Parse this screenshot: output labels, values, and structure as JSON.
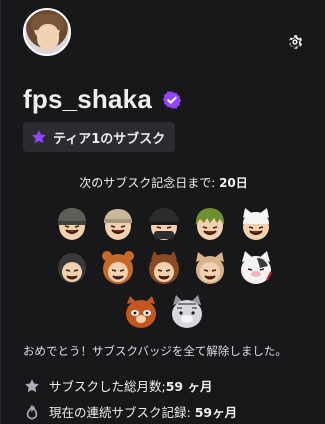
{
  "profile": {
    "username": "fps_shaka",
    "avatar_icon": "user-avatar",
    "verified_icon": "verified-check-icon"
  },
  "header": {
    "settings_icon": "gear-icon"
  },
  "subscription": {
    "tier_label": "ティア1のサブスク",
    "next_anniversary_prefix": "次のサブスク記念日まで: ",
    "next_anniversary_value": "20日"
  },
  "badges": {
    "row1": [
      "helmet-badge",
      "bandana-badge",
      "combat-helmet-badge",
      "green-hair-badge",
      "white-cat-ears-badge"
    ],
    "row2": [
      "gorilla-badge",
      "bear-hood-badge",
      "horse-hood-badge",
      "cat-ears-badge",
      "calico-cat-badge"
    ],
    "row3": [
      "red-panda-badge",
      "tabby-cat-badge"
    ]
  },
  "message": "おめでとう！サブスクバッジを全て解除しました。",
  "stats": {
    "total_label": "サブスクした総月数;",
    "total_value": "59 ヶ月",
    "streak_label": "現在の連続サブスク記録: ",
    "streak_value": "59ヶ月"
  },
  "colors": {
    "background": "#18181b",
    "accent": "#9147ff",
    "badge_bg": "#2b2b31",
    "text": "#efeff1"
  }
}
